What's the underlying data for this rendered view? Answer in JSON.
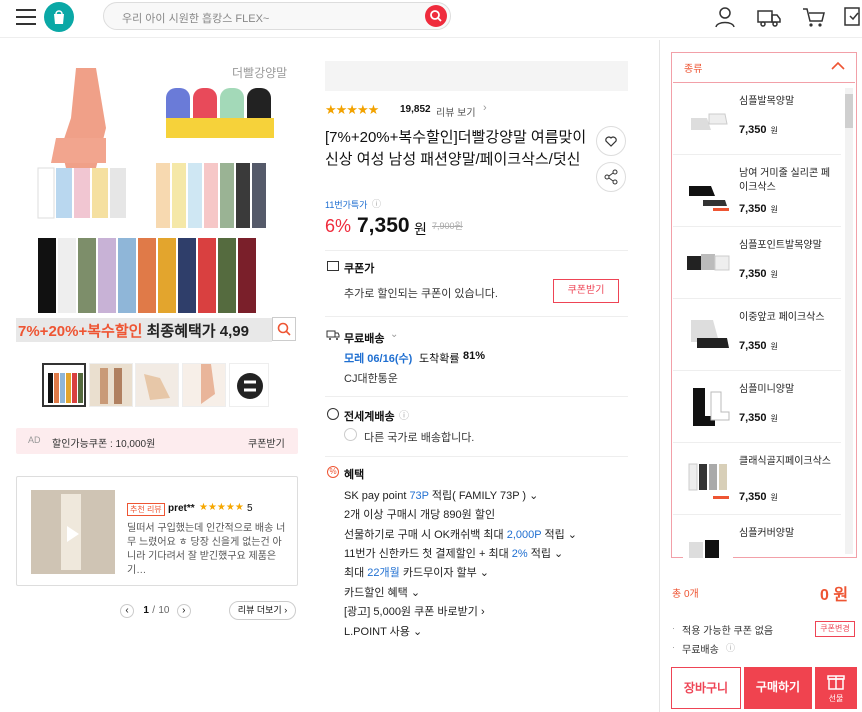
{
  "header": {
    "search_placeholder": "우리 아이 시원한 흡캉스 FLEX~",
    "icons": [
      "menu-icon",
      "app-logo",
      "search-icon",
      "user-icon",
      "truck-icon",
      "cart-icon",
      "recent-icon"
    ]
  },
  "gallery": {
    "brand_watermark": "더빨강양말",
    "banner_text_red": "7%+20%+복수할인",
    "banner_text_dark": " 최종혜택가 4,99",
    "ad_label": "AD",
    "ad_text": "할인가능쿠폰 : 10,000원",
    "ad_button": "쿠폰받기"
  },
  "review": {
    "tag": "추천 리뷰",
    "user": "pret**",
    "stars": "★★★★★",
    "score": "5",
    "text": "딜떠서 구입했는데 인간적으로 배송 너무 느렸어요 ㅎ 당장 신을게 없는건 아니라 기다려서 잘 받긴했구요 제품은 기…",
    "page_current": "1",
    "page_sep": "/",
    "page_total": "10",
    "more_button": "리뷰 더보기 ›"
  },
  "product": {
    "rating_stars": "★★★★★",
    "rating_value": 4.5,
    "review_count": "19,852",
    "review_link": "리뷰 보기",
    "title": "[7%+20%+복수할인]더빨강양말 여름맞이 신상 여성 남성 패션양말/페이크삭스/덧신",
    "badge": "11번가특가",
    "discount": "6%",
    "price": "7,350",
    "price_unit": "원",
    "original_price": "7,900원",
    "coupon_title": "쿠폰가",
    "coupon_desc": "추가로 할인되는 쿠폰이 있습니다.",
    "coupon_button": "쿠폰받기",
    "shipping_title": "무료배송",
    "shipping_date_blue": "모레 06/16(수)",
    "shipping_prob_label": "도착확률",
    "shipping_prob": "81%",
    "carrier": "CJ대한통운",
    "global_title": "전세계배송",
    "global_desc": "다른 국가로 배송합니다.",
    "benefit_title": "혜택",
    "benefits": [
      {
        "a": "SK pay point ",
        "b": "73P",
        "c": " 적립( FAMILY 73P ) ⌄"
      },
      {
        "a": "2개 이상 구매시 개당 890원 할인",
        "b": "",
        "c": ""
      },
      {
        "a": "선물하기로 구매 시 OK캐쉬백 최대 ",
        "b": "2,000P",
        "c": " 적립 ⌄"
      },
      {
        "a": "11번가 신한카드 첫 결제할인 + 최대 ",
        "b": "2%",
        "c": " 적립 ⌄"
      },
      {
        "a": "최대 ",
        "b": "22개월",
        "c": " 카드무이자 할부 ⌄"
      },
      {
        "a": "카드할인 혜택 ⌄",
        "b": "",
        "c": ""
      },
      {
        "a": "[광고] 5,000원 쿠폰 바로받기 ›",
        "b": "",
        "c": ""
      },
      {
        "a": "L.POINT 사용 ⌄",
        "b": "",
        "c": ""
      }
    ]
  },
  "sidebar": {
    "title": "종류",
    "items": [
      {
        "name": "심플발목양말",
        "price": "7,350",
        "unit": "원"
      },
      {
        "name": "남여 거미줄 실리콘 페이크삭스",
        "price": "7,350",
        "unit": "원"
      },
      {
        "name": "심플포인트발목양말",
        "price": "7,350",
        "unit": "원"
      },
      {
        "name": "이중앞코 페이크삭스",
        "price": "7,350",
        "unit": "원"
      },
      {
        "name": "심플미니양말",
        "price": "7,350",
        "unit": "원"
      },
      {
        "name": "클래식골지페이크삭스",
        "price": "7,350",
        "unit": "원"
      },
      {
        "name": "심플커버양말",
        "price": "",
        "unit": ""
      }
    ],
    "total_label": "총 0개",
    "total_price": "0 원",
    "coupon_none": "적용 가능한 쿠폰 없음",
    "coupon_change": "쿠폰변경",
    "free_shipping": "무료배송",
    "cart_button": "장바구니",
    "buy_button": "구매하기",
    "gift_button": "선물"
  },
  "colors": {
    "accent": "#ef2b3c",
    "blue": "#1f6fd1",
    "teal": "#0aa8a6"
  }
}
